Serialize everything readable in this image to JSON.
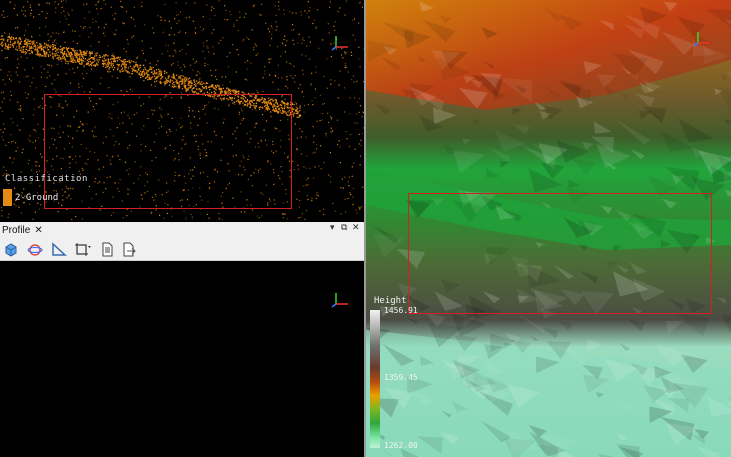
{
  "top_left_view": {
    "legend_title": "Classification",
    "legend_item": "2-Ground",
    "legend_color": "#e58a12"
  },
  "profile_panel": {
    "tab_label": "Profile",
    "tab_close": "✕",
    "pin_symbol": "▾",
    "float_symbol": "⧉",
    "close_symbol": "✕",
    "tools": [
      "cube-icon",
      "rotate-view-icon",
      "measure-triangle-icon",
      "crop-frame-icon",
      "document-icon",
      "export-icon"
    ]
  },
  "right_view": {
    "height_title": "Height",
    "height_max": "1456.91",
    "height_mid": "1359.45",
    "height_min": "1262.00"
  },
  "colors": {
    "selection": "#d32020",
    "ground_points": "#e58a12"
  }
}
